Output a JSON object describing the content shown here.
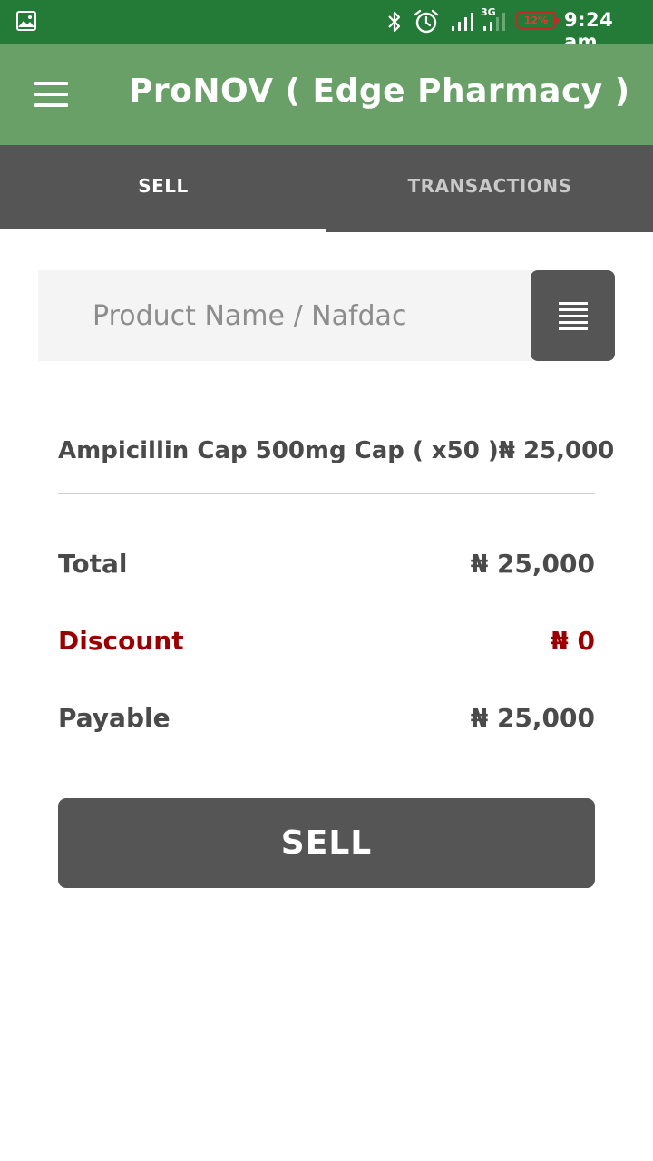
{
  "status_bar": {
    "network_type": "3G",
    "battery_percent": "12%",
    "time": "9:24 am",
    "icons": [
      "gallery-icon",
      "bluetooth-icon",
      "alarm-icon",
      "signal-icon",
      "signal-icon"
    ]
  },
  "app_bar": {
    "title": "ProNOV ( Edge Pharmacy )",
    "menu_icon": "menu-icon"
  },
  "tabs": [
    {
      "label": "SELL",
      "active": true
    },
    {
      "label": "TRANSACTIONS",
      "active": false
    }
  ],
  "search": {
    "placeholder": "Product Name / Nafdac",
    "value": "",
    "list_icon": "list-icon"
  },
  "cart": {
    "items": [
      {
        "name": "Ampicillin Cap 500mg Cap ( x50 )",
        "price": "₦ 25,000"
      }
    ]
  },
  "summary": {
    "total_label": "Total",
    "total_value": "₦ 25,000",
    "discount_label": "Discount",
    "discount_value": "₦ 0",
    "payable_label": "Payable",
    "payable_value": "₦ 25,000"
  },
  "sell_button": {
    "label": "SELL"
  },
  "colors": {
    "status_bar": "#247a37",
    "app_bar": "#69a067",
    "dark_gray": "#555555",
    "discount_red": "#9b0000"
  }
}
